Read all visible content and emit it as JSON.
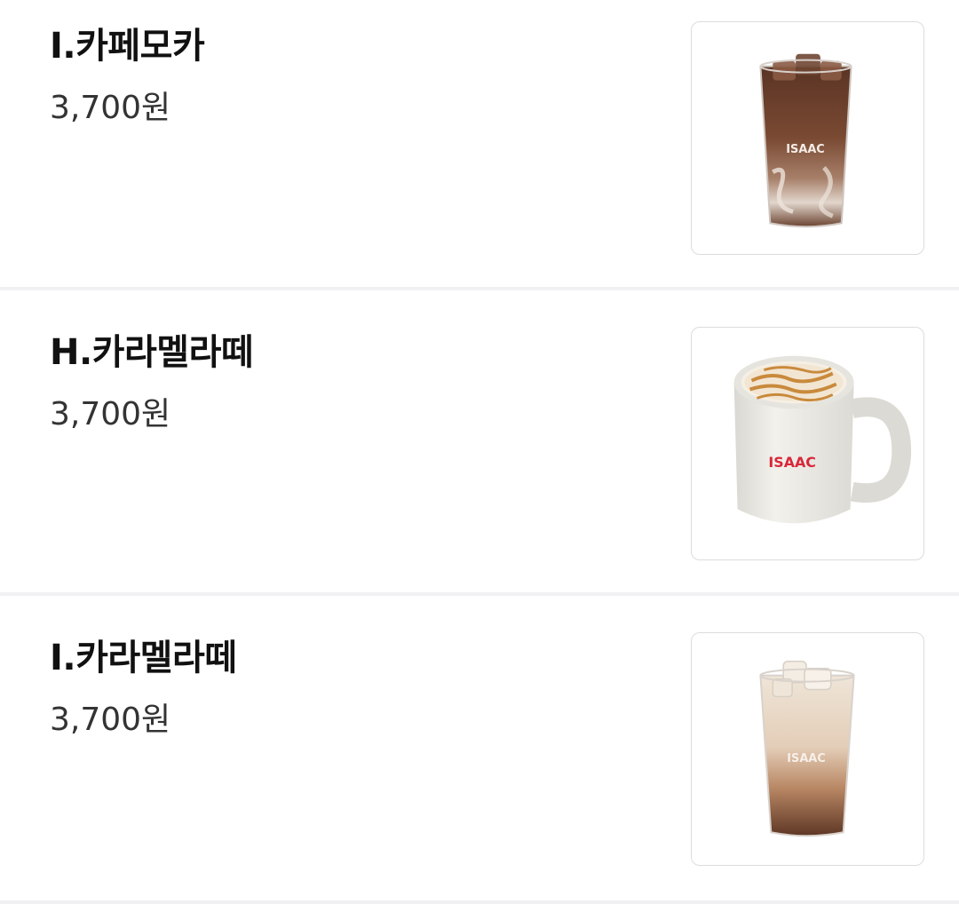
{
  "menu": {
    "items": [
      {
        "name": "I.카페모카",
        "price": "3,700원",
        "image": {
          "icon": "iced-mocha-glass-image",
          "logo": "ISAAC"
        }
      },
      {
        "name": "H.카라멜라떼",
        "price": "3,700원",
        "image": {
          "icon": "hot-caramel-latte-mug-image",
          "logo": "ISAAC"
        }
      },
      {
        "name": "I.카라멜라떼",
        "price": "3,700원",
        "image": {
          "icon": "iced-caramel-latte-glass-image",
          "logo": "ISAAC"
        }
      }
    ]
  },
  "colors": {
    "divider": "#f1f1f3",
    "thumb_border": "#dcdcdc",
    "brand_red": "#d8283a"
  }
}
